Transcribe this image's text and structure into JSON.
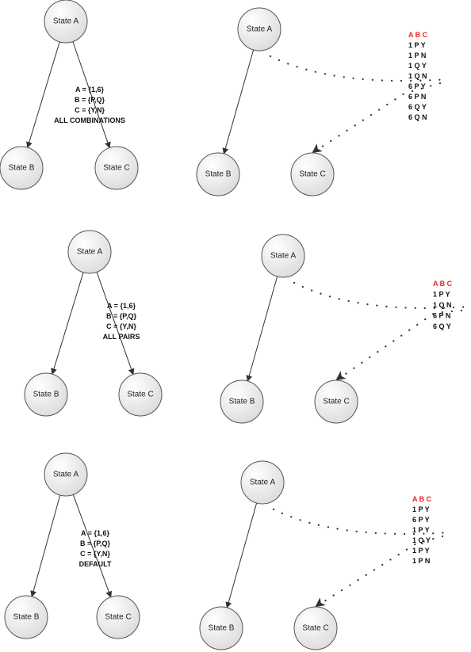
{
  "colors": {
    "header": "#ee2222",
    "text": "#111111",
    "node_stroke": "#555555"
  },
  "diagrams": [
    {
      "nodes": {
        "a": "State A",
        "b": "State B",
        "c": "State C"
      },
      "set_lines": [
        "A = {1,6}",
        "B = {P,Q}",
        "C = {Y,N}",
        "ALL COMBINATIONS"
      ],
      "table_header": "A B C",
      "table_rows": [
        "1 P Y",
        "1 P N",
        "1 Q Y",
        "1 Q N",
        "6 P Y",
        "6 P N",
        "6 Q Y",
        "6 Q N"
      ]
    },
    {
      "nodes": {
        "a": "State A",
        "b": "State B",
        "c": "State C"
      },
      "set_lines": [
        "A = {1,6}",
        "B = {P,Q}",
        "C = {Y,N}",
        "ALL PAIRS"
      ],
      "table_header": "A B C",
      "table_rows": [
        "1 P Y",
        "1 Q N",
        "6 P N",
        "6 Q Y"
      ]
    },
    {
      "nodes": {
        "a": "State A",
        "b": "State B",
        "c": "State C"
      },
      "set_lines": [
        "A = {1,6}",
        "B = {P,Q}",
        "C = {Y,N}",
        "DEFAULT"
      ],
      "table_header": "A B C",
      "table_rows": [
        "1 P Y",
        "6 P Y",
        "1 P Y",
        "1 Q Y",
        "1 P Y",
        "1 P N"
      ]
    }
  ]
}
